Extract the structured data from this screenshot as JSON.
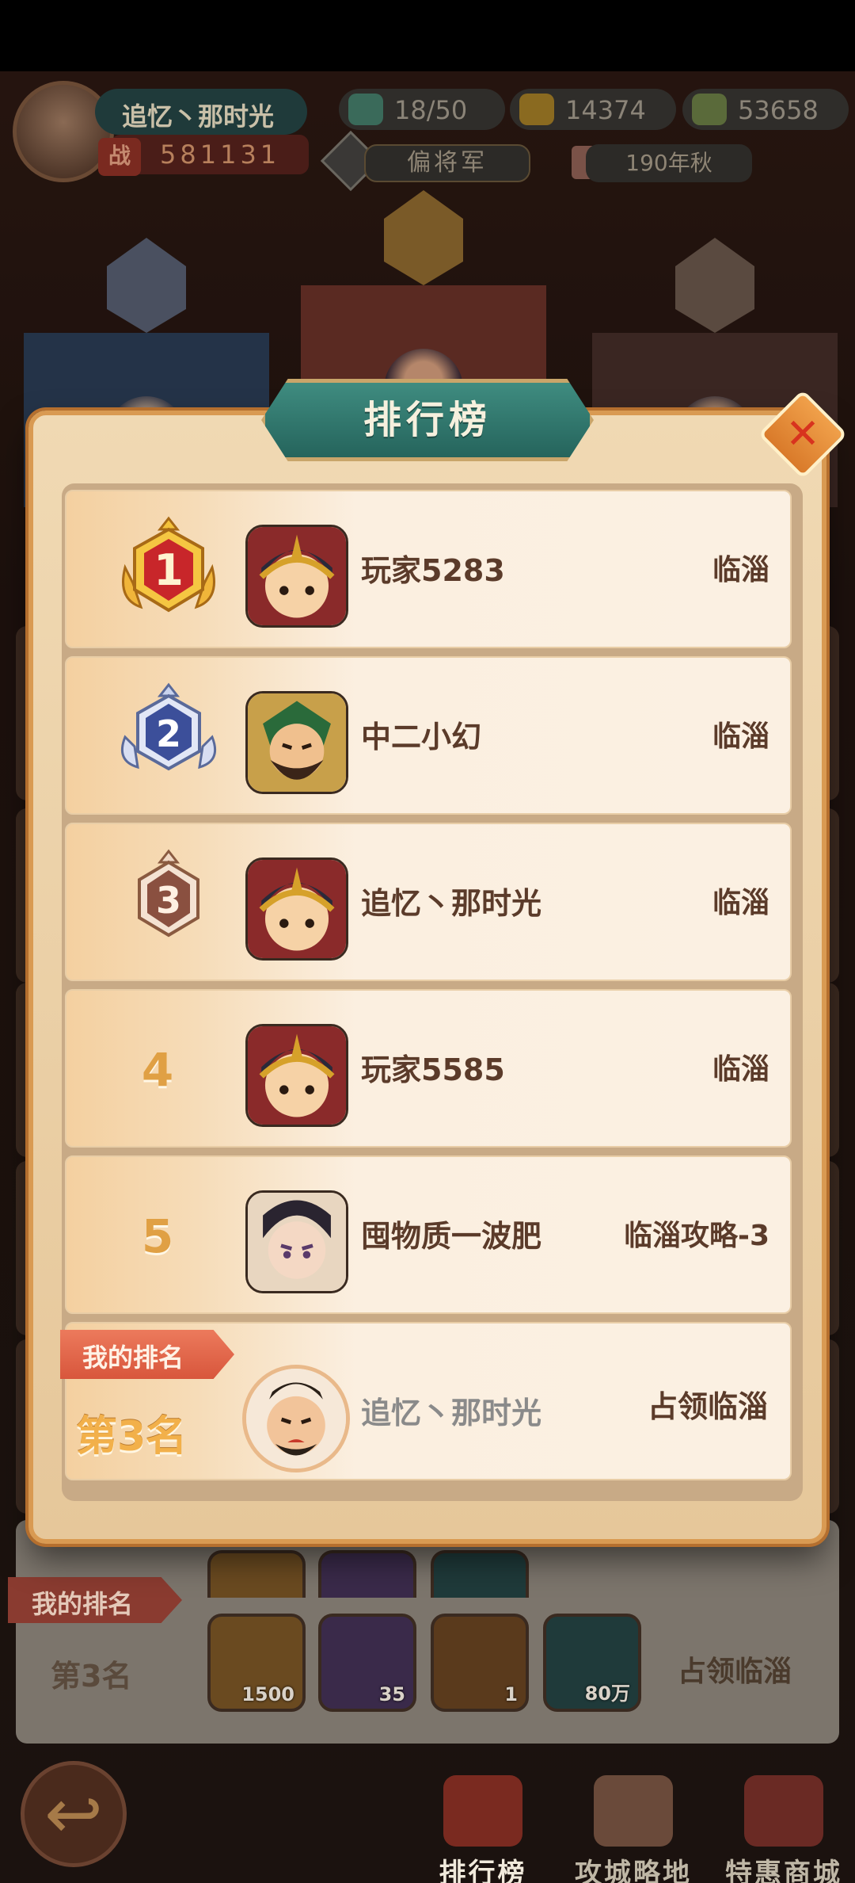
{
  "player": {
    "name": "追忆丶那时光",
    "power_icon_label": "战",
    "power": "581131",
    "rank_title": "偏将军",
    "season": "190年秋"
  },
  "resources": [
    {
      "icon": "stamina-icon",
      "value": "18/50",
      "color": "#3a6a5a"
    },
    {
      "icon": "gold-ingot-icon",
      "value": "14374",
      "color": "#8a6a20"
    },
    {
      "icon": "copper-coin-icon",
      "value": "53658",
      "color": "#5a6a3a"
    }
  ],
  "dialog": {
    "title": "排行榜",
    "close_label": "✕"
  },
  "ranking": [
    {
      "rank": "1",
      "name": "玩家5283",
      "city": "临淄",
      "avatar": "helmet-avatar"
    },
    {
      "rank": "2",
      "name": "中二小幻",
      "city": "临淄",
      "avatar": "general-avatar"
    },
    {
      "rank": "3",
      "name": "追忆丶那时光",
      "city": "临淄",
      "avatar": "helmet-avatar"
    },
    {
      "rank": "4",
      "name": "玩家5585",
      "city": "临淄",
      "avatar": "helmet-avatar"
    },
    {
      "rank": "5",
      "name": "囤物质一波肥",
      "city": "临淄攻略-3",
      "avatar": "strategist-avatar"
    }
  ],
  "my_rank": {
    "tag": "我的排名",
    "rank_text": "第3名",
    "name": "追忆丶那时光",
    "status": "占领临淄"
  },
  "bottom_panel": {
    "tag": "我的排名",
    "rank_text": "第3名",
    "status": "占领临淄",
    "rewards": [
      {
        "icon": "gold-ingot-icon",
        "amount": "1500"
      },
      {
        "icon": "purple-chest-icon",
        "amount": "35"
      },
      {
        "icon": "bronze-chest-icon",
        "amount": "1"
      },
      {
        "icon": "copper-coin-icon",
        "amount": "80万"
      }
    ]
  },
  "nav": {
    "back_icon": "↩",
    "tabs": [
      {
        "label": "排行榜",
        "icon": "ranking-icon",
        "active": true
      },
      {
        "label": "攻城略地",
        "icon": "siege-map-icon",
        "active": false
      },
      {
        "label": "特惠商城",
        "icon": "shop-icon",
        "active": false
      }
    ]
  }
}
